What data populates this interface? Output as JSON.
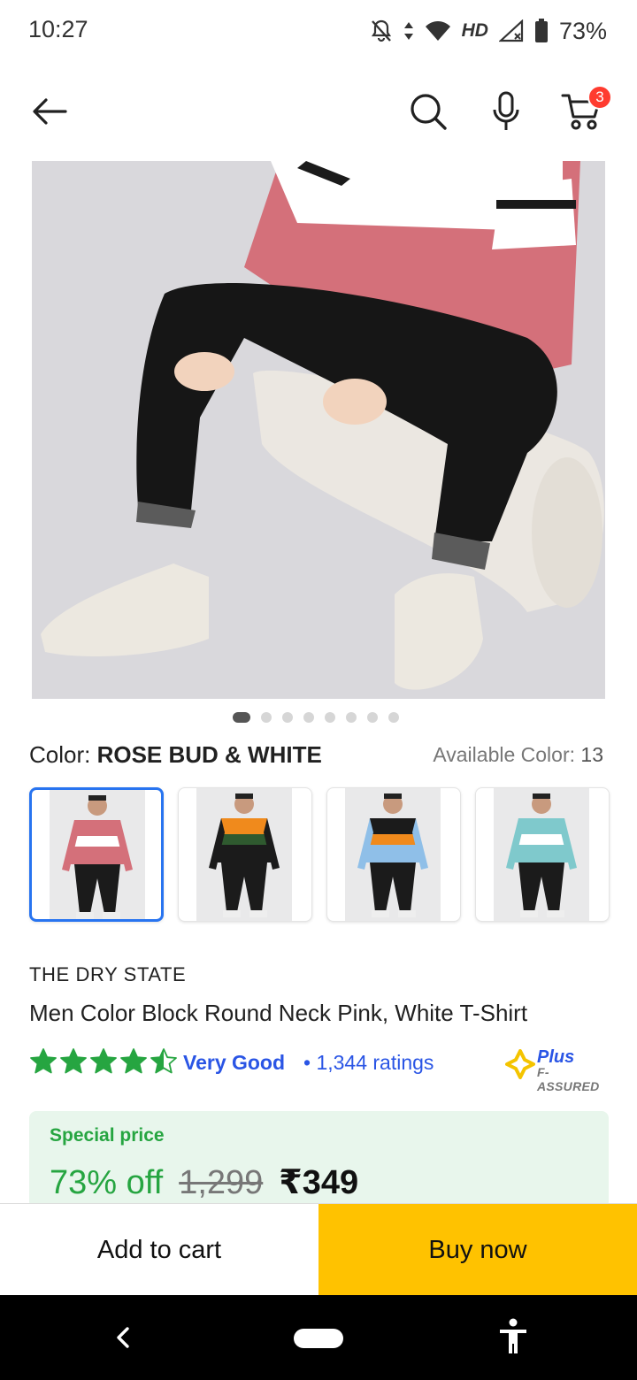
{
  "status_bar": {
    "time": "10:27",
    "network_label": "HD",
    "battery": "73%"
  },
  "top_bar": {
    "cart_badge": "3",
    "icons": [
      "back-arrow-icon",
      "search-icon",
      "microphone-icon",
      "cart-icon"
    ]
  },
  "gallery": {
    "total_images": 8,
    "active_index": 0
  },
  "color": {
    "label": "Color:",
    "value": "ROSE BUD & WHITE",
    "available_label": "Available Color:",
    "available_count": "13",
    "swatches": [
      {
        "name": "rose-bud-white",
        "top": "#d4707a",
        "stripe": "#ffffff",
        "bottom": "#d4707a",
        "selected": true
      },
      {
        "name": "orange-green-black",
        "top": "#f08a1c",
        "stripe": "#2f5a2f",
        "bottom": "#1b1b1b",
        "selected": false
      },
      {
        "name": "black-orange-blue",
        "top": "#1b1b1b",
        "stripe": "#f08a1c",
        "bottom": "#8fbfe8",
        "selected": false
      },
      {
        "name": "aqua-white",
        "top": "#7fc9cc",
        "stripe": "#ffffff",
        "bottom": "#7fc9cc",
        "selected": false
      }
    ]
  },
  "product": {
    "brand": "THE DRY STATE",
    "title": "Men Color Block Round Neck Pink, White T-Shirt",
    "rating_stars": 4.5,
    "rating_text": "Very Good",
    "rating_count": "• 1,344 ratings",
    "assured_plus": "Plus",
    "assured_sub": "F-ASSURED"
  },
  "price": {
    "label": "Special price",
    "discount": "73% off",
    "mrp": "1,299",
    "price": "₹349"
  },
  "actions": {
    "add_to_cart": "Add to cart",
    "buy_now": "Buy now"
  },
  "colors": {
    "accent_blue": "#2874f0",
    "rating_green": "#26a541",
    "buy_yellow": "#ffc200",
    "badge_red": "#ff3b2f"
  }
}
